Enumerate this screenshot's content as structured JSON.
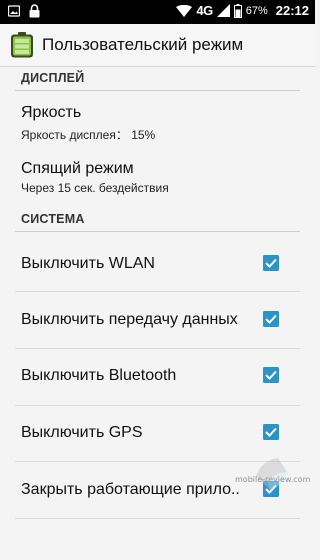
{
  "status_bar": {
    "network": "4G",
    "battery_percent": "67%",
    "time": "22:12",
    "icons": [
      "image-icon",
      "lock-icon",
      "wifi-icon",
      "signal-icon",
      "battery-icon"
    ]
  },
  "app_bar": {
    "title": "Пользовательский режим",
    "icon": "battery-app-icon"
  },
  "sections": {
    "display": {
      "header": "ДИСПЛЕЙ",
      "brightness": {
        "title": "Яркость",
        "summary": "Яркость дисплея： 15%"
      },
      "sleep": {
        "title": "Спящий режим",
        "summary": "Через 15 сек. бездействия"
      }
    },
    "system": {
      "header": "СИСТЕМА",
      "items": [
        {
          "label": "Выключить WLAN",
          "checked": true
        },
        {
          "label": "Выключить передачу данных",
          "checked": true
        },
        {
          "label": "Выключить Bluetooth",
          "checked": true
        },
        {
          "label": "Выключить GPS",
          "checked": true
        },
        {
          "label": "Закрыть работающие прило..",
          "checked": true
        }
      ]
    }
  },
  "watermark": {
    "text": "mobile-review.com"
  },
  "colors": {
    "accent": "#2a93c7",
    "app_icon_green": "#8bc34a"
  }
}
